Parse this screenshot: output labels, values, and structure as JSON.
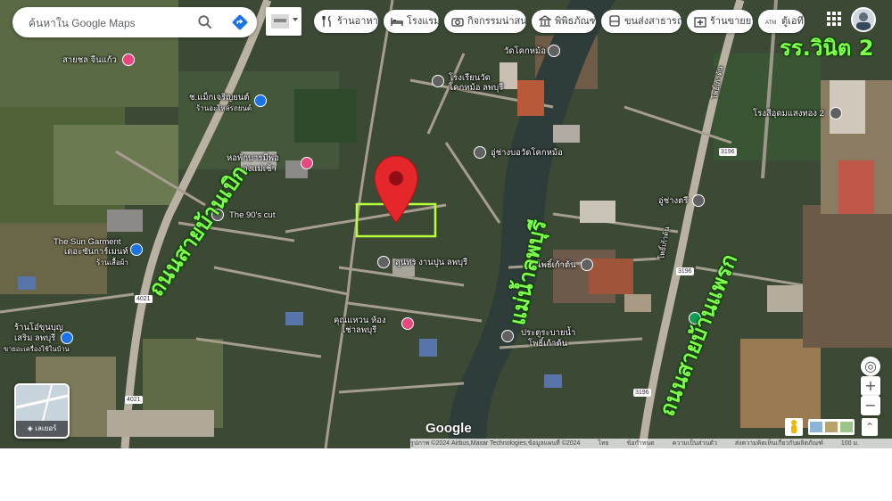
{
  "search": {
    "placeholder": "ค้นหาใน Google Maps"
  },
  "chips": [
    {
      "label": "ร้านอาหาร",
      "icon": "fork-knife-icon"
    },
    {
      "label": "โรงแรม",
      "icon": "bed-icon"
    },
    {
      "label": "กิจกรรมน่าสนใจ",
      "icon": "camera-icon"
    },
    {
      "label": "พิพิธภัณฑ์",
      "icon": "museum-icon"
    },
    {
      "label": "ขนส่งสาธารณะ",
      "icon": "bus-icon"
    },
    {
      "label": "ร้านขายยา",
      "icon": "pharmacy-icon"
    },
    {
      "label": "ตู้เอทีเ",
      "icon": "atm-icon"
    }
  ],
  "annotations": {
    "school": "รร.วินิต 2",
    "road_left": "ถนนสายบ้านเบิก",
    "river": "แม่น้ำลพบุรี",
    "road_right": "ถนนสายบ้านแพรก"
  },
  "places": {
    "p1": "สายชล จีนแก้ว",
    "p2": "ช.แม็กเจริญยนต์",
    "p2b": "ร้านอะไหล่รถยนต์",
    "p3": "วัดโคกหม้อ",
    "p4a": "โรงเรียนวัด",
    "p4b": "โคกหม้อ ลพบุรี",
    "p5": "โรงสีอุดมแสงทอง 2",
    "p6": "อู่ช่างบอวัดโคกหม้อ",
    "p7a": "หอพักบารมีพ่อ",
    "p7b": "องแม่เช้า",
    "p8": "The 90's cut",
    "p9": "อู่ช่างตรี",
    "p10a": "The Sun Garment",
    "p10b": "เดอะซันการ์เมนท์",
    "p10c": "ร้านเสื้อผ้า",
    "p11": "สุนทร งานปูน ลพบุรี",
    "p12": "วัดโพธิ์เก้าต้น",
    "p13a": "ร้านโอ๋ขุนบุญ",
    "p13b": "เสริม ลพบุรี",
    "p13c": "ขายอะเครื่องใช้ในบ้าน",
    "p14a": "คุณแหวน ห้อง",
    "p14b": "เช่าลพบุรี",
    "p15a": "ประตูระบายน้ำ",
    "p15b": "โพธิ์เก้าต้น",
    "r1": "โพธิ์เก้าต้น",
    "r2": "โพธิ์เก้าต้น"
  },
  "road_numbers": {
    "a": "4021",
    "b": "4021",
    "c": "3196",
    "d": "3196",
    "e": "3196"
  },
  "layers": {
    "label": "เลเยอร์"
  },
  "zoom": {
    "in": "+",
    "out": "−"
  },
  "brand": "Google",
  "footer": {
    "attribution": "รูปภาพ ©2024 Airbus,Maxar Technologies,ข้อมูลแผนที่ ©2024",
    "lang": "ไทย",
    "terms": "ข้อกำหนด",
    "privacy": "ความเป็นส่วนตัว",
    "feedback": "ส่งความคิดเห็นเกี่ยวกับผลิตภัณฑ์",
    "scale": "100 ม."
  },
  "colors": {
    "annotation": "#7dff4a",
    "pin_red": "#e5262b",
    "pin_blue": "#1a73e8",
    "pin_pink": "#e8487e",
    "highlight": "#b6ff3a"
  }
}
